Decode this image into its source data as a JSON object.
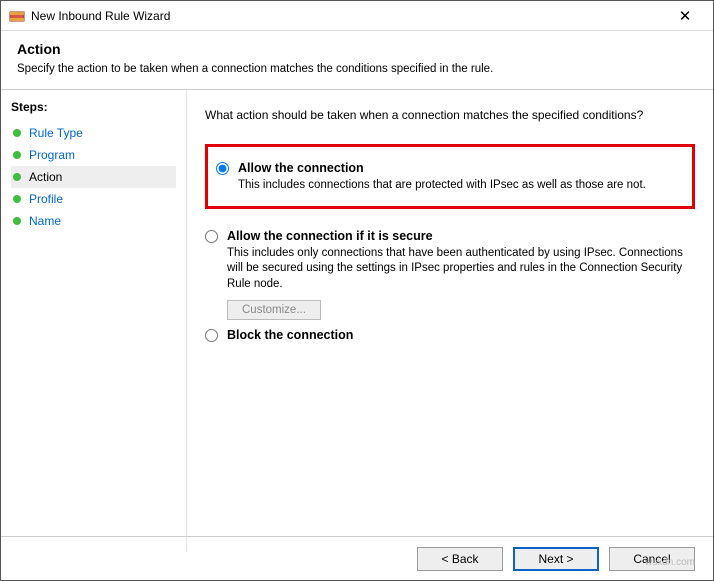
{
  "titlebar": {
    "title": "New Inbound Rule Wizard"
  },
  "header": {
    "title": "Action",
    "subtitle": "Specify the action to be taken when a connection matches the conditions specified in the rule."
  },
  "sidebar": {
    "title": "Steps:",
    "items": [
      {
        "label": "Rule Type",
        "state": "link"
      },
      {
        "label": "Program",
        "state": "link"
      },
      {
        "label": "Action",
        "state": "current"
      },
      {
        "label": "Profile",
        "state": "link"
      },
      {
        "label": "Name",
        "state": "link"
      }
    ]
  },
  "content": {
    "prompt": "What action should be taken when a connection matches the specified conditions?",
    "options": [
      {
        "title": "Allow the connection",
        "desc": "This includes connections that are protected with IPsec as well as those are not.",
        "selected": true,
        "highlight": true
      },
      {
        "title": "Allow the connection if it is secure",
        "desc": "This includes only connections that have been authenticated by using IPsec. Connections will be secured using the settings in IPsec properties and rules in the Connection Security Rule node.",
        "selected": false,
        "customize_label": "Customize..."
      },
      {
        "title": "Block the connection",
        "desc": "",
        "selected": false
      }
    ]
  },
  "footer": {
    "back": "< Back",
    "next": "Next >",
    "cancel": "Cancel"
  },
  "watermark": "wsxdn.com"
}
